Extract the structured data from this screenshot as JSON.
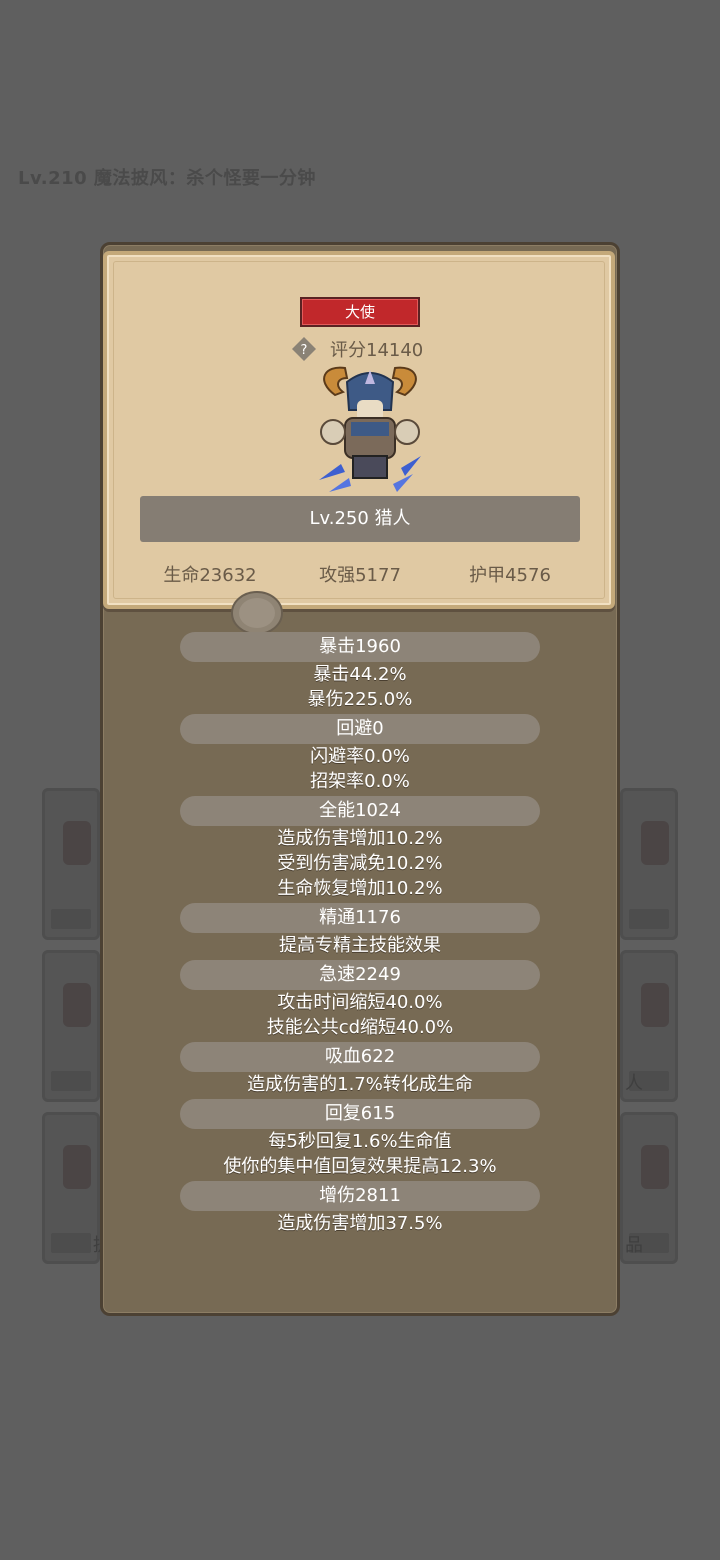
{
  "background": {
    "title": "Lv.210 魔法披风：杀个怪要一分钟",
    "right_card_labels": [
      "人",
      "品"
    ],
    "left_card_labels": [
      "提"
    ]
  },
  "panel": {
    "tag": "大使",
    "score": "评分14140",
    "name": "Lv.250 猎人",
    "stats": [
      "生命23632",
      "攻强5177",
      "护甲4576"
    ],
    "attributes": [
      {
        "header": "暴击1960",
        "lines": [
          "暴击44.2%",
          "暴伤225.0%"
        ]
      },
      {
        "header": "回避0",
        "lines": [
          "闪避率0.0%",
          "招架率0.0%"
        ]
      },
      {
        "header": "全能1024",
        "lines": [
          "造成伤害增加10.2%",
          "受到伤害减免10.2%",
          "生命恢复增加10.2%"
        ]
      },
      {
        "header": "精通1176",
        "lines": [
          "提高专精主技能效果"
        ]
      },
      {
        "header": "急速2249",
        "lines": [
          "攻击时间缩短40.0%",
          "技能公共cd缩短40.0%"
        ]
      },
      {
        "header": "吸血622",
        "lines": [
          "造成伤害的1.7%转化成生命"
        ]
      },
      {
        "header": "回复615",
        "lines": [
          "每5秒回复1.6%生命值",
          "使你的集中值回复效果提高12.3%"
        ]
      },
      {
        "header": "增伤2811",
        "lines": [
          "造成伤害增加37.5%"
        ]
      }
    ]
  },
  "colors": {
    "tag_red": "#c1282b",
    "parchment": "#e0c9a3",
    "panel_brown": "#776a54"
  }
}
